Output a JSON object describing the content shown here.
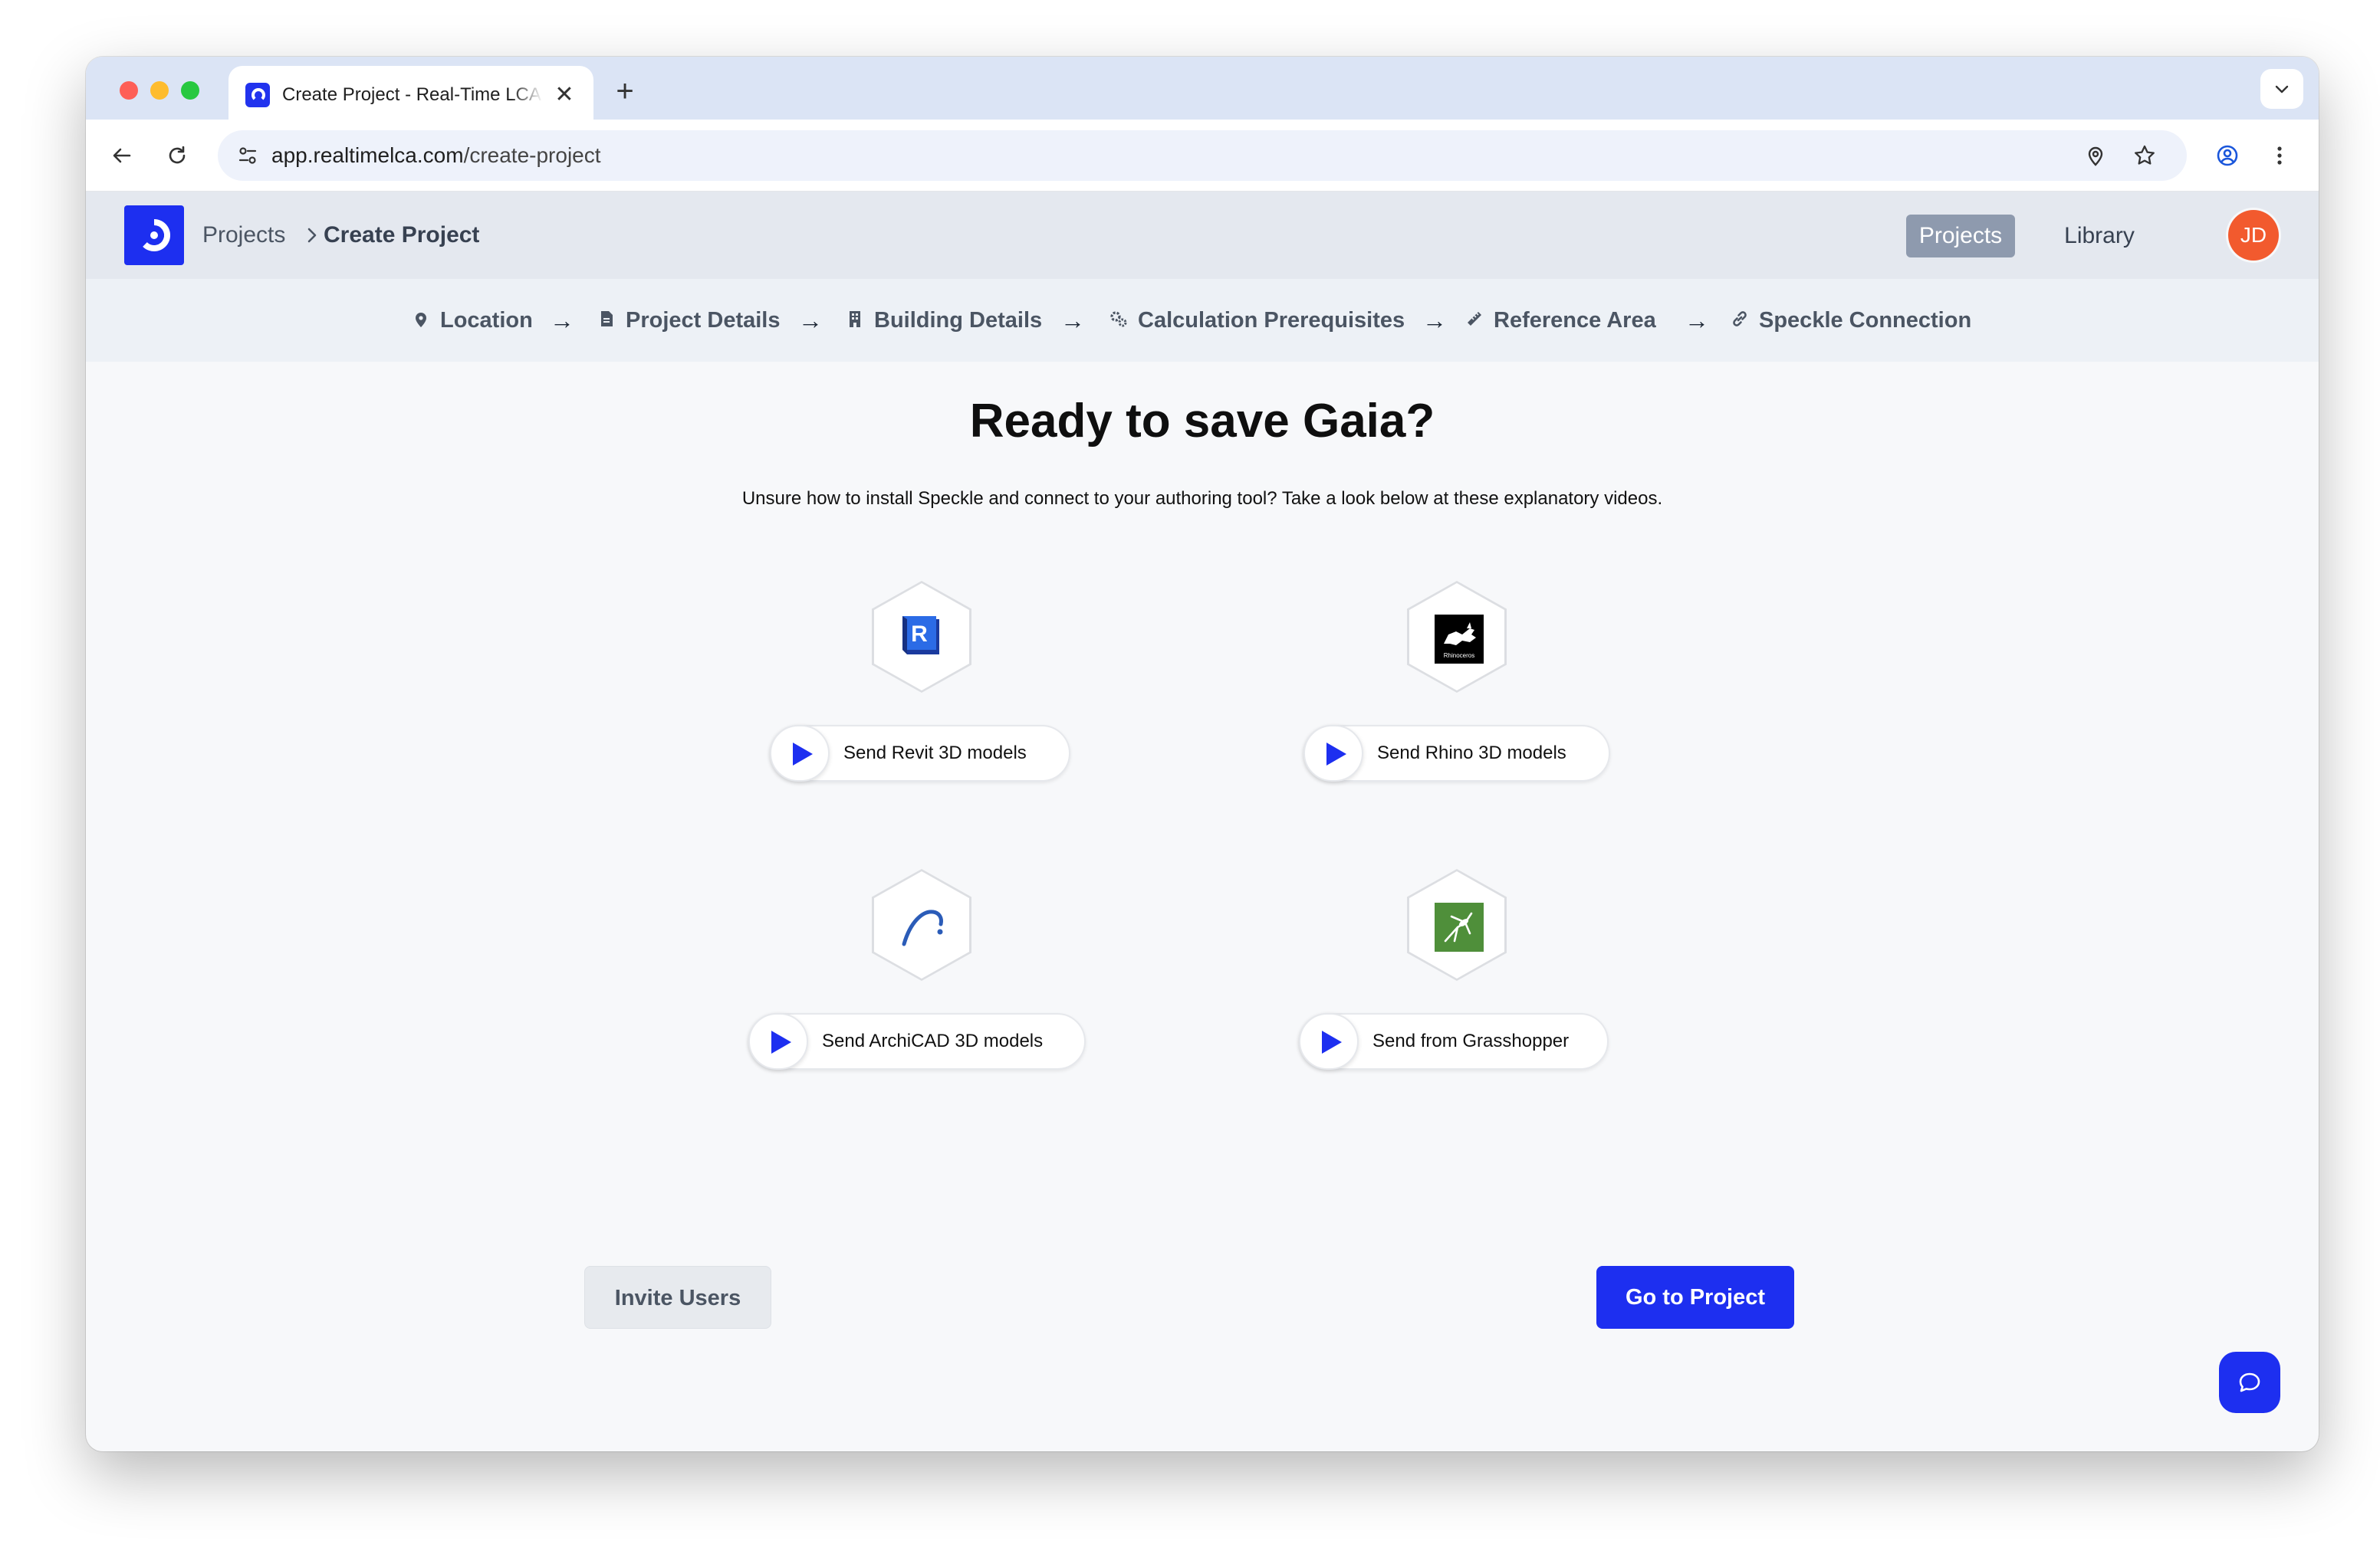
{
  "browser": {
    "tab_title": "Create Project - Real-Time LCA",
    "new_tab_label": "+",
    "close_tab_label": "✕",
    "url_host": "app.realtimelca.com",
    "url_path": "/create-project"
  },
  "header": {
    "breadcrumb_parent": "Projects",
    "breadcrumb_current": "Create Project",
    "nav_projects": "Projects",
    "nav_library": "Library",
    "avatar_initials": "JD"
  },
  "stepper": {
    "arrow": "→",
    "steps": [
      {
        "label": "Location",
        "icon": "map-pin-icon"
      },
      {
        "label": "Project Details",
        "icon": "document-icon"
      },
      {
        "label": "Building Details",
        "icon": "building-icon"
      },
      {
        "label": "Calculation Prerequisites",
        "icon": "gears-icon"
      },
      {
        "label": "Reference Area",
        "icon": "ruler-icon"
      },
      {
        "label": "Speckle Connection",
        "icon": "link-icon"
      }
    ]
  },
  "main": {
    "title": "Ready to save Gaia?",
    "subtitle": "Unsure how to install Speckle and connect to your authoring tool? Take a look below at these explanatory videos.",
    "videos": [
      {
        "label": "Send Revit 3D models",
        "logo": "revit-logo"
      },
      {
        "label": "Send Rhino 3D models",
        "logo": "rhino-logo"
      },
      {
        "label": "Send ArchiCAD 3D models",
        "logo": "archicad-logo"
      },
      {
        "label": "Send from Grasshopper",
        "logo": "grasshopper-logo"
      }
    ],
    "rhino_logo_text": "Rhinoceros",
    "invite_users_label": "Invite Users",
    "go_to_project_label": "Go to Project"
  },
  "colors": {
    "brand": "#1d2ff0",
    "avatar": "#f25a2e",
    "active_nav": "#8e9aae"
  }
}
